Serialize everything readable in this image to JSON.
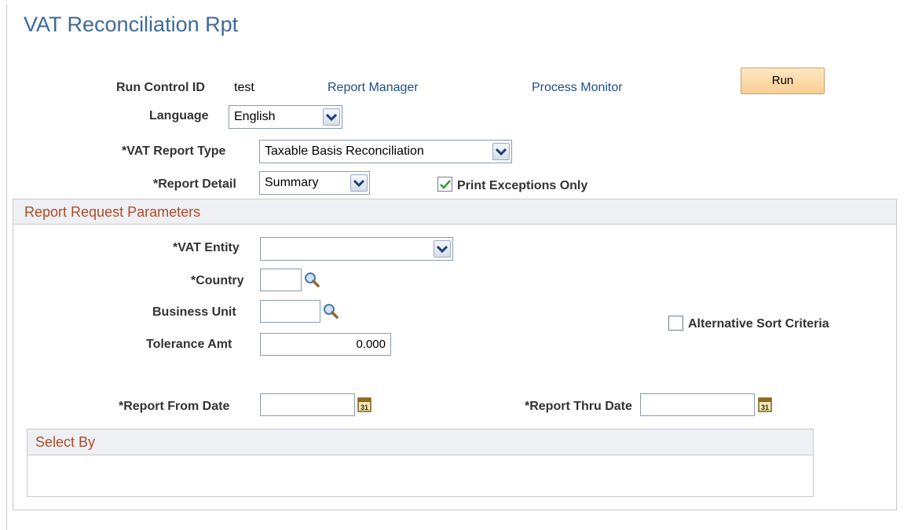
{
  "page": {
    "title": "VAT Reconciliation Rpt"
  },
  "run_control": {
    "label": "Run Control ID",
    "value": "test",
    "report_manager": "Report Manager",
    "process_monitor": "Process Monitor",
    "run_button": "Run"
  },
  "language": {
    "label": "Language",
    "selected": "English"
  },
  "vat_report_type": {
    "label": "*VAT Report Type",
    "selected": "Taxable Basis Reconciliation"
  },
  "report_detail": {
    "label": "*Report Detail",
    "selected": "Summary"
  },
  "print_exceptions": {
    "label": "Print Exceptions Only",
    "checked": true
  },
  "report_params": {
    "title": "Report Request Parameters",
    "vat_entity": {
      "label": "*VAT Entity",
      "selected": ""
    },
    "country": {
      "label": "*Country",
      "value": ""
    },
    "business_unit": {
      "label": "Business Unit",
      "value": ""
    },
    "tolerance_amt": {
      "label": "Tolerance Amt",
      "value": "0.000"
    },
    "alt_sort": {
      "label": "Alternative Sort Criteria",
      "checked": false
    },
    "from_date": {
      "label": "*Report From Date",
      "value": ""
    },
    "thru_date": {
      "label": "*Report Thru Date",
      "value": ""
    }
  },
  "select_by": {
    "title": "Select By"
  },
  "colors": {
    "title": "#3e6a99",
    "link": "#1f4e8c",
    "section_title": "#b04a28",
    "check": "#2e9a2e"
  },
  "icons": {
    "dropdown": "chevron-down-icon",
    "lookup": "magnifier-icon",
    "calendar": "calendar-icon"
  }
}
